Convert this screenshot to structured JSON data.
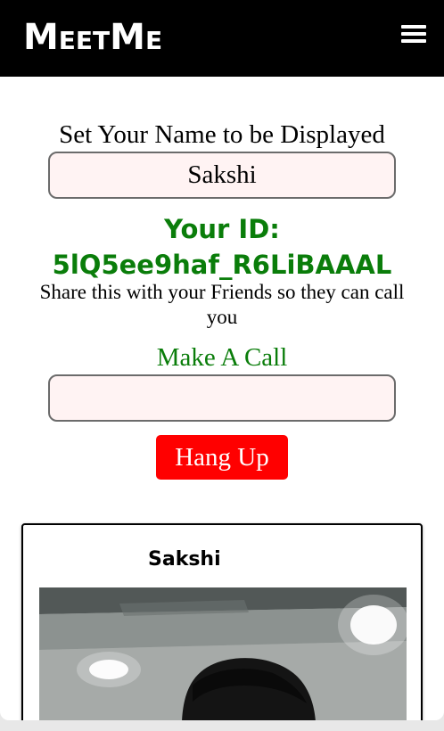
{
  "header": {
    "brand": "MeetMe",
    "menu_icon": "hamburger-menu-icon"
  },
  "name_section": {
    "label": "Set Your Name to be Displayed",
    "value": "Sakshi"
  },
  "id_section": {
    "label": "Your ID:",
    "value": "5lQ5ee9haf_R6LiBAAAL",
    "note": "Share this with your Friends so they can call you"
  },
  "call_section": {
    "label": "Make A Call",
    "value": "",
    "hangup_label": "Hang Up"
  },
  "video": {
    "participant_name": "Sakshi"
  },
  "colors": {
    "topbar": "#000000",
    "accent_green": "#0a7d0a",
    "hangup_red": "#ff0000",
    "input_bg": "#fff3f3"
  }
}
